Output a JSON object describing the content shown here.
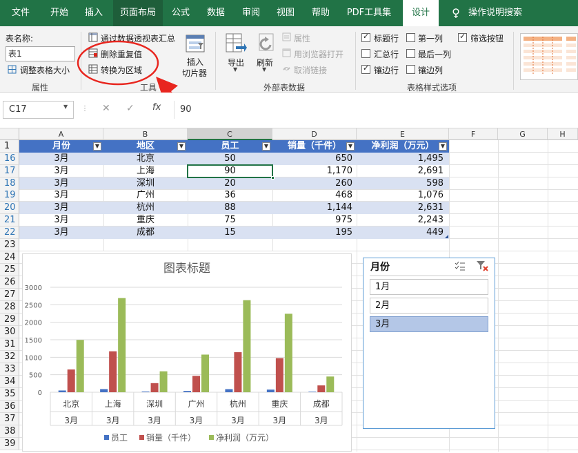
{
  "tabs": {
    "file": "文件",
    "home": "开始",
    "insert": "插入",
    "page_layout": "页面布局",
    "formulas": "公式",
    "data": "数据",
    "review": "审阅",
    "view": "视图",
    "help": "帮助",
    "pdf": "PDF工具集",
    "design": "设计",
    "tell_me": "操作说明搜索"
  },
  "ribbon": {
    "properties": {
      "table_name_label": "表名称:",
      "table_name_value": "表1",
      "resize": "调整表格大小",
      "group": "属性"
    },
    "tools": {
      "pivot": "通过数据透视表汇总",
      "remove_dup": "删除重复值",
      "convert": "转换为区域",
      "insert_slicer_1": "插入",
      "insert_slicer_2": "切片器",
      "group": "工具"
    },
    "external": {
      "export": "导出",
      "refresh": "刷新",
      "properties": "属性",
      "open_browser": "用浏览器打开",
      "unlink": "取消链接",
      "group": "外部表数据"
    },
    "style_options": {
      "header_row": "标题行",
      "first_col": "第一列",
      "filter_btn": "筛选按钮",
      "total_row": "汇总行",
      "last_col": "最后一列",
      "banded_rows": "镶边行",
      "banded_cols": "镶边列",
      "group": "表格样式选项"
    }
  },
  "formula_bar": {
    "name_box": "C17",
    "fx": "fx",
    "value": "90"
  },
  "columns": [
    "A",
    "B",
    "C",
    "D",
    "E",
    "F",
    "G",
    "H"
  ],
  "rows": [
    "1",
    "16",
    "17",
    "18",
    "19",
    "20",
    "21",
    "22",
    "23",
    "24",
    "25",
    "26",
    "27",
    "28",
    "29",
    "30",
    "31",
    "32",
    "33",
    "34",
    "35",
    "36",
    "37",
    "38",
    "39"
  ],
  "table": {
    "headers": [
      "月份",
      "地区",
      "员工",
      "销量（千件）",
      "净利润（万元）"
    ],
    "data": [
      [
        "3月",
        "北京",
        "50",
        "650",
        "1,495"
      ],
      [
        "3月",
        "上海",
        "90",
        "1,170",
        "2,691"
      ],
      [
        "3月",
        "深圳",
        "20",
        "260",
        "598"
      ],
      [
        "3月",
        "广州",
        "36",
        "468",
        "1,076"
      ],
      [
        "3月",
        "杭州",
        "88",
        "1,144",
        "2,631"
      ],
      [
        "3月",
        "重庆",
        "75",
        "975",
        "2,243"
      ],
      [
        "3月",
        "成都",
        "15",
        "195",
        "449"
      ]
    ]
  },
  "chart_data": {
    "type": "bar",
    "title": "图表标题",
    "categories": [
      "北京",
      "上海",
      "深圳",
      "广州",
      "杭州",
      "重庆",
      "成都"
    ],
    "category_group": "3月",
    "series": [
      {
        "name": "员工",
        "values": [
          50,
          90,
          20,
          36,
          88,
          75,
          15
        ],
        "color": "#4472c4"
      },
      {
        "name": "销量（千件）",
        "values": [
          650,
          1170,
          260,
          468,
          1144,
          975,
          195
        ],
        "color": "#c0504d"
      },
      {
        "name": "净利润（万元）",
        "values": [
          1495,
          2691,
          598,
          1076,
          2631,
          2243,
          449
        ],
        "color": "#9bbb59"
      }
    ],
    "yticks": [
      "0",
      "500",
      "1000",
      "1500",
      "2000",
      "2500",
      "3000"
    ],
    "ylim": [
      0,
      3000
    ],
    "legend": "bottom",
    "grid": true
  },
  "slicer": {
    "title": "月份",
    "items": [
      "1月",
      "2月",
      "3月"
    ],
    "selected": "3月"
  },
  "colors": {
    "excel_green": "#217346",
    "table_header": "#4472c4",
    "band": "#d9e1f2",
    "annotation": "#e8261f"
  }
}
